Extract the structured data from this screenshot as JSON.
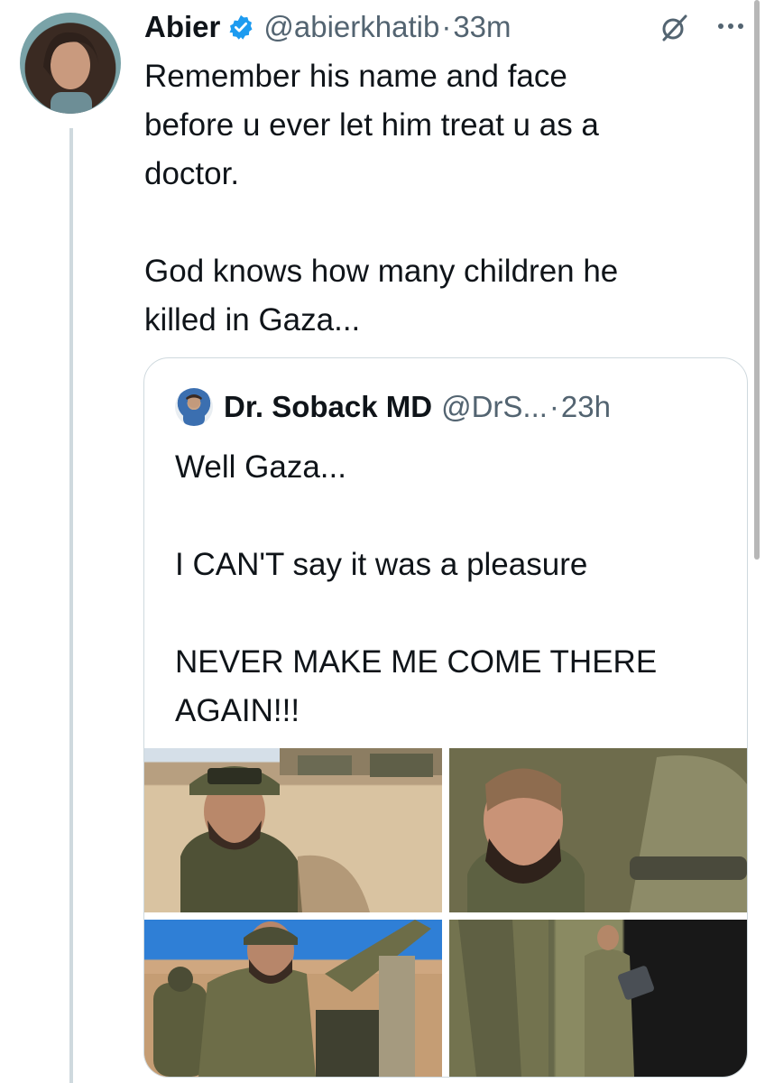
{
  "tweet": {
    "author_name": "Abier",
    "handle": "@abierkhatib",
    "separator": "·",
    "time": "33m",
    "text": "Remember his name and face\nbefore u ever let him treat u as a\ndoctor.\n\nGod knows how many children he\nkilled in Gaza...",
    "verified_icon": "verified-badge-icon",
    "grok_icon": "grok-icon",
    "more_icon": "more-options-icon"
  },
  "quote": {
    "author_name": "Dr. Soback MD",
    "handle": "@DrS...",
    "separator": "·",
    "time": "23h",
    "text": "Well Gaza...\n\nI CAN'T say it was a pleasure\n\nNEVER MAKE ME COME THERE\nAGAIN!!!",
    "media_count": 4
  },
  "colors": {
    "accent": "#1d9bf0",
    "secondary_text": "#536471",
    "border": "#cfd9de"
  }
}
